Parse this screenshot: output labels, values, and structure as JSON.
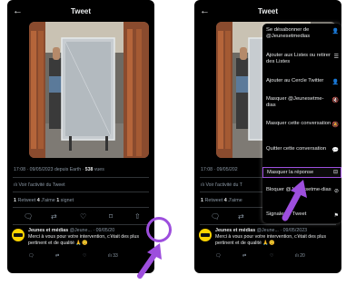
{
  "colors": {
    "highlight": "#9d4edd",
    "background": "#000000",
    "text": "#e7e9ea",
    "muted": "#8b98a5",
    "avatar": "#ffd400"
  },
  "header": {
    "back_icon": "back-arrow-icon",
    "back_glyph": "←",
    "title": "Tweet"
  },
  "tweet": {
    "meta_time": "17:08 · 09/05/2023 depuis Earth · ",
    "meta_views_count": "538",
    "meta_views_label": " vues",
    "meta_time_short": "17:08 · 09/05/202",
    "activity_icon": "chart-icon",
    "activity": "Voir l'activité du Tweet",
    "activity_short": "Voir l'activité du T",
    "retweets_count": "1",
    "retweets_label": " Retweet ",
    "likes_count": "4",
    "likes_label": " J'aime ",
    "bookmarks_count": "1",
    "bookmarks_label": " signet",
    "action_icons": [
      "reply-icon",
      "retweet-icon",
      "like-icon",
      "bookmark-icon",
      "share-icon"
    ]
  },
  "reply": {
    "name": "Jeunes et médias",
    "handle_left": " @Jeune... · 09/05/20",
    "handle_right": "@Jeune... · 09/05/2023",
    "text_left": "Merci à vous pour votre intervention, c'était des plus pertinent et de qualité 🙏😊",
    "text_right": "Merci à vous pour votre intervention, c'était des plus pertinent et de qualité 🙏😊",
    "views_left": "33",
    "views_right": "20"
  },
  "menu": {
    "items": [
      {
        "label": "Se désabonner de @Jeunesetmedias",
        "icon": "unfollow-icon",
        "glyph": "👤"
      },
      {
        "label": "Ajouter aux Listes ou retirer des Listes",
        "icon": "list-icon",
        "glyph": "☰"
      },
      {
        "label": "Ajouter au Cercle Twitter",
        "icon": "circle-icon",
        "glyph": "👤"
      },
      {
        "label": "Masquer @Jeunesetme-dias",
        "icon": "mute-icon",
        "glyph": "🔇"
      },
      {
        "label": "Masquer cette conversation",
        "icon": "mute-conversation-icon",
        "glyph": "🔕"
      },
      {
        "label": "Quitter cette conversation",
        "icon": "leave-conversation-icon",
        "glyph": "💬"
      },
      {
        "label": "Masquer la réponse",
        "icon": "hide-reply-icon",
        "glyph": "⊟",
        "highlighted": true
      },
      {
        "label": "Bloquer @Jeunesetme-dias",
        "icon": "block-icon",
        "glyph": "⊘"
      },
      {
        "label": "Signaler le Tweet",
        "icon": "report-icon",
        "glyph": "⚑"
      }
    ]
  }
}
